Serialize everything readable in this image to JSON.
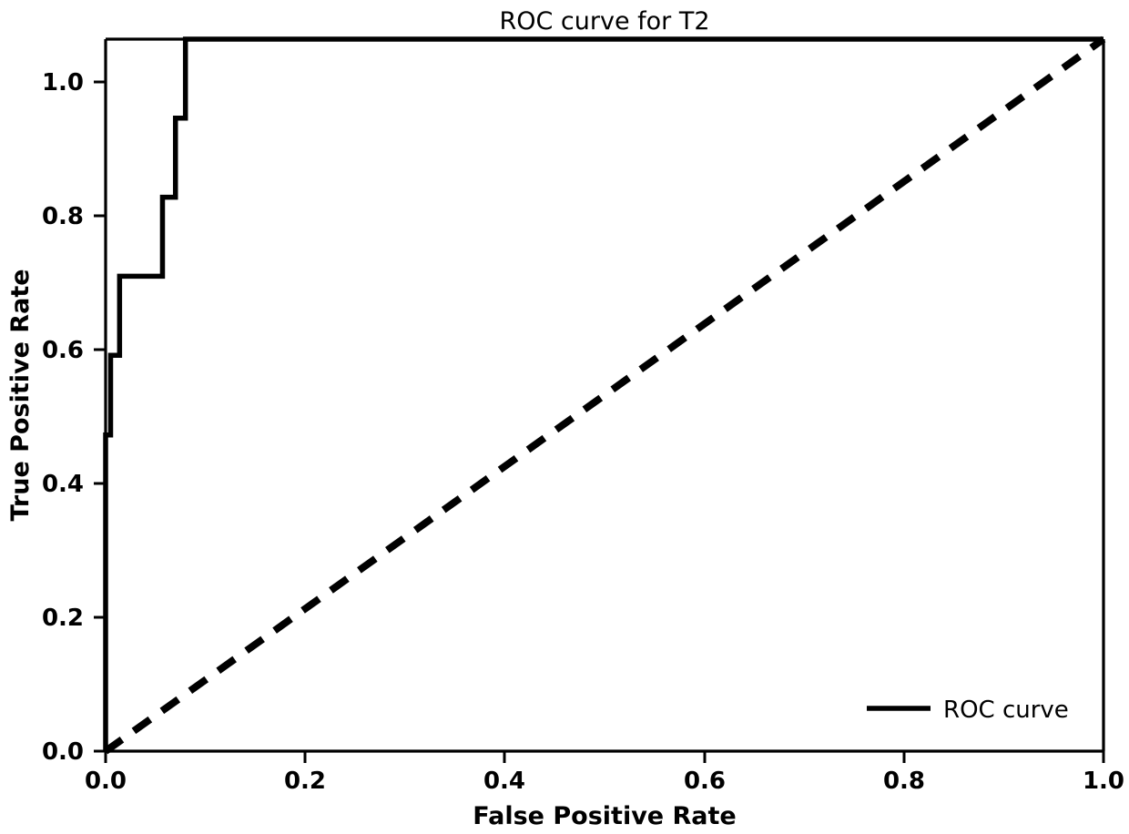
{
  "figure": {
    "title": "ROC curve for T2",
    "background_color": "#ffffff",
    "foreground_color": "#000000"
  },
  "axes": {
    "xlabel": "False Positive Rate",
    "ylabel": "True Positive Rate",
    "xticks": [
      "0.0",
      "0.2",
      "0.4",
      "0.6",
      "0.8",
      "1.0"
    ],
    "yticks": [
      "0.0",
      "0.2",
      "0.4",
      "0.6",
      "0.8",
      "1.0"
    ]
  },
  "legend": {
    "entries": [
      {
        "label": "ROC curve",
        "style": "solid",
        "color": "#000000"
      }
    ],
    "position": "lower right",
    "frame": false
  },
  "chart_data": {
    "type": "line",
    "title": "ROC curve for T2",
    "xlabel": "False Positive Rate",
    "ylabel": "True Positive Rate",
    "xlim": [
      0.0,
      1.0
    ],
    "ylim": [
      0.0,
      1.0
    ],
    "xticks": [
      0.0,
      0.2,
      0.4,
      0.6,
      0.8,
      1.0
    ],
    "yticks": [
      0.0,
      0.2,
      0.4,
      0.6,
      0.8,
      1.0
    ],
    "grid": false,
    "legend_position": "lower right",
    "series": [
      {
        "name": "ROC curve",
        "linestyle": "solid",
        "color": "#000000",
        "linewidth": 2,
        "drawstyle": "steps-post",
        "x": [
          0.0,
          0.0,
          0.005,
          0.005,
          0.014,
          0.014,
          0.057,
          0.057,
          0.07,
          0.07,
          0.08,
          0.08,
          1.0
        ],
        "y": [
          0.0,
          0.444,
          0.444,
          0.556,
          0.556,
          0.667,
          0.667,
          0.778,
          0.778,
          0.889,
          0.889,
          1.0,
          1.0
        ]
      },
      {
        "name": "chance",
        "linestyle": "dashed",
        "color": "#000000",
        "linewidth": 3,
        "in_legend": false,
        "x": [
          0.0,
          1.0
        ],
        "y": [
          0.0,
          1.0
        ]
      }
    ]
  }
}
